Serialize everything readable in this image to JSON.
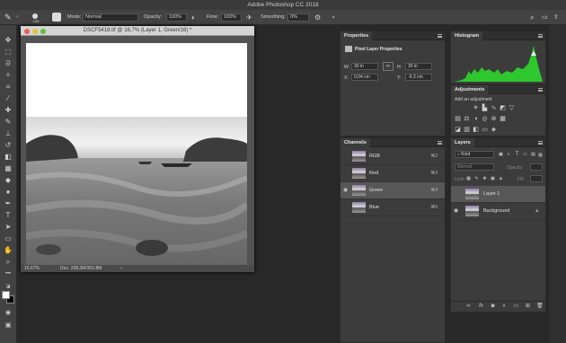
{
  "app": {
    "title": "Adobe Photoshop CC 2018"
  },
  "options_bar": {
    "brush_size": "100",
    "mode_label": "Mode:",
    "mode_value": "Normal",
    "opacity_label": "Opacity:",
    "opacity_value": "100%",
    "flow_label": "Flow:",
    "flow_value": "100%",
    "smoothing_label": "Smoothing:",
    "smoothing_value": "0%"
  },
  "document": {
    "title": "DSCF5418.tif @ 16,7% (Layer 1, Green/16) *",
    "zoom": "16,67%",
    "doc_info": "Doc: 208,2M/303,8M"
  },
  "properties": {
    "tab": "Properties",
    "heading": "Pixel Layer Properties",
    "w_label": "W:",
    "w_value": "30 in",
    "h_label": "H:",
    "h_value": "30 in",
    "x_label": "X:",
    "x_value": "0,04 cm",
    "y_label": "Y:",
    "y_value": "-9,3 cm"
  },
  "channels": {
    "tab": "Channels",
    "items": [
      {
        "label": "RGB",
        "shortcut": "⌘2",
        "visible": false,
        "selected": false
      },
      {
        "label": "Red",
        "shortcut": "⌘3",
        "visible": false,
        "selected": false
      },
      {
        "label": "Green",
        "shortcut": "⌘4",
        "visible": true,
        "selected": true
      },
      {
        "label": "Blue",
        "shortcut": "⌘5",
        "visible": false,
        "selected": false
      }
    ]
  },
  "histogram": {
    "tab": "Histogram"
  },
  "adjustments": {
    "tab": "Adjustments",
    "heading": "Add an adjustment"
  },
  "layers": {
    "tab": "Layers",
    "kind_label": "Kind",
    "blend_mode": "Normal",
    "opacity_label": "Opacity:",
    "lock_label": "Lock:",
    "fill_label": "Fill:",
    "items": [
      {
        "label": "Layer 1",
        "selected": true,
        "visible": false
      },
      {
        "label": "Background",
        "selected": false,
        "visible": true,
        "locked": true
      }
    ]
  },
  "colors": {
    "histogram_fill": "#2ec82e",
    "panel_bg": "#3c3c3c",
    "app_bg": "#282828",
    "selected_row": "#575757"
  }
}
